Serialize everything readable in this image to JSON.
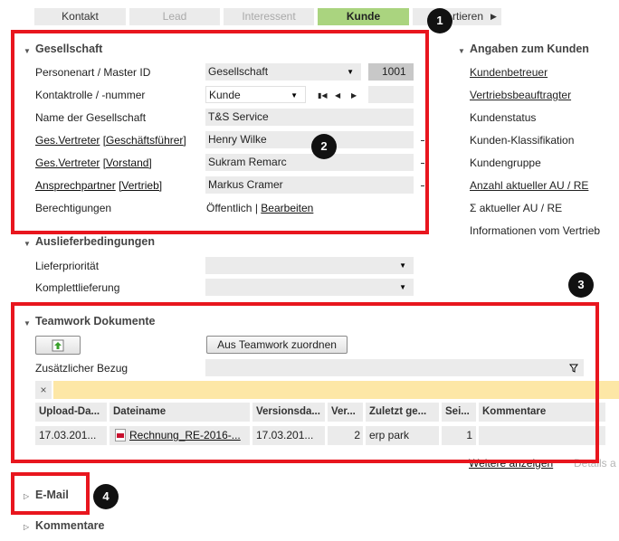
{
  "tabs": {
    "kontakt": "Kontakt",
    "lead": "Lead",
    "interessent": "Interessent",
    "kunde": "Kunde",
    "more": "rtieren"
  },
  "badges": [
    "1",
    "2",
    "3",
    "4"
  ],
  "gesellschaft": {
    "title": "Gesellschaft",
    "personenart_label": "Personenart / Master ID",
    "personenart_value": "Gesellschaft",
    "master_id": "1001",
    "kontaktrolle_label": "Kontaktrolle / -nummer",
    "kontaktrolle_value": "Kunde",
    "name_label": "Name der Gesellschaft",
    "name_value": "T&S Service",
    "vertreter1_link": "Ges.Vertreter",
    "vertreter1_role": "[Geschäftsführer]",
    "vertreter1_value": "Henry Wilke",
    "vertreter2_link": "Ges.Vertreter",
    "vertreter2_role": "[Vorstand]",
    "vertreter2_value": "Sukram Remarc",
    "ansprech_link": "Ansprechpartner",
    "ansprech_role": "[Vertrieb]",
    "ansprech_value": "Markus Cramer",
    "berechtigungen_label": "Berechtigungen",
    "berechtigungen_value": "Öffentlich",
    "sep": "|",
    "bearbeiten": "Bearbeiten"
  },
  "kunde": {
    "title": "Angaben zum Kunden",
    "items": [
      "Kundenbetreuer",
      "Vertriebsbeauftragter",
      "Kundenstatus",
      "Kunden-Klassifikation",
      "Kundengruppe",
      "Anzahl aktueller AU / RE",
      "Σ aktueller AU / RE",
      "Informationen vom Vertrieb"
    ]
  },
  "auslieferung": {
    "title": "Auslieferbedingungen",
    "prioritaet_label": "Lieferpriorität",
    "komplett_label": "Komplettlieferung"
  },
  "teamwork": {
    "title": "Teamwork Dokumente",
    "assign_button": "Aus Teamwork zuordnen",
    "bezug_label": "Zusätzlicher Bezug",
    "clear": "×",
    "columns": [
      "Upload-Da...",
      "Dateiname",
      "Versionsda...",
      "Ver...",
      "Zuletzt ge...",
      "Sei...",
      "Kommentare"
    ],
    "rows": [
      [
        "17.03.201...",
        "Rechnung_RE-2016-...",
        "17.03.201...",
        "2",
        "erp park",
        "1",
        ""
      ]
    ],
    "more_link": "Weitere anzeigen",
    "details": "Details a"
  },
  "email": {
    "title": "E-Mail"
  },
  "kommentare": {
    "title": "Kommentare"
  },
  "colors": {
    "active_tab": "#aad47f",
    "highlight": "#e8161e",
    "filter_bar": "#fde7a6"
  }
}
